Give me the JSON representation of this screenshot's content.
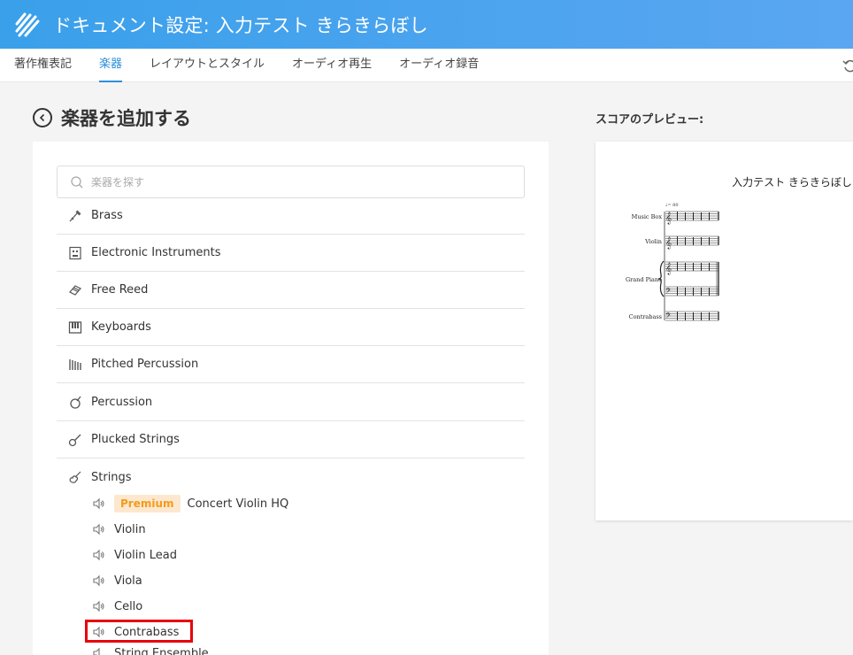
{
  "header": {
    "title": "ドキュメント設定: 入力テスト きらきらぼし"
  },
  "tabs": [
    {
      "label": "著作権表記"
    },
    {
      "label": "楽器"
    },
    {
      "label": "レイアウトとスタイル"
    },
    {
      "label": "オーディオ再生"
    },
    {
      "label": "オーディオ録音"
    }
  ],
  "page": {
    "title": "楽器を追加する"
  },
  "search": {
    "placeholder": "楽器を探す",
    "value": ""
  },
  "categories": [
    {
      "label": "Brass",
      "icon": "trumpet-icon"
    },
    {
      "label": "Electronic Instruments",
      "icon": "synth-icon"
    },
    {
      "label": "Free Reed",
      "icon": "accordion-icon"
    },
    {
      "label": "Keyboards",
      "icon": "piano-keys-icon"
    },
    {
      "label": "Pitched Percussion",
      "icon": "xylophone-icon"
    },
    {
      "label": "Percussion",
      "icon": "drum-icon"
    },
    {
      "label": "Plucked Strings",
      "icon": "guitar-icon"
    },
    {
      "label": "Strings",
      "icon": "violin-icon"
    }
  ],
  "strings_instruments": [
    {
      "label": "Concert Violin HQ",
      "badge": "Premium"
    },
    {
      "label": "Violin"
    },
    {
      "label": "Violin Lead"
    },
    {
      "label": "Viola"
    },
    {
      "label": "Cello"
    },
    {
      "label": "Contrabass",
      "highlighted": true
    },
    {
      "label": "String Ensemble"
    }
  ],
  "preview": {
    "label": "スコアのプレビュー:",
    "score_title": "入力テスト きらきらぼし",
    "tempo": "♩= 80",
    "staves": [
      "Music Box",
      "Violin",
      "Grand Piano",
      "Contrabass"
    ]
  },
  "colors": {
    "header": "#3aa0ea",
    "accent": "#2d8fd9",
    "premium_bg": "#fde8cf",
    "premium_fg": "#f39b1c",
    "highlight": "#e8000b"
  }
}
